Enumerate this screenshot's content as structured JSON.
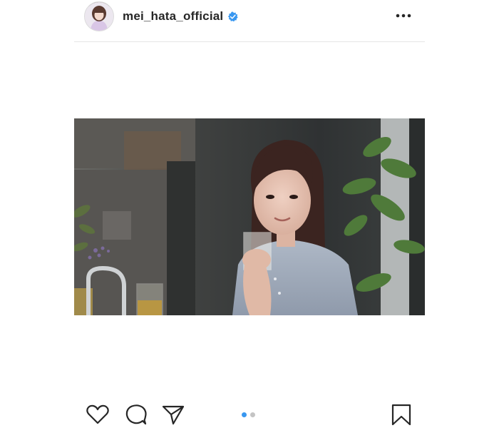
{
  "post": {
    "username": "mei_hata_official",
    "verified": true,
    "avatar_icon": "profile-avatar",
    "more_icon": "more-horizontal-icon"
  },
  "media": {
    "type": "photo",
    "carousel_total": 2,
    "carousel_active_index": 0
  },
  "actions": {
    "like_icon": "heart-icon",
    "comment_icon": "comment-bubble-icon",
    "share_icon": "paper-plane-icon",
    "save_icon": "bookmark-icon"
  },
  "colors": {
    "text": "#262626",
    "verified": "#3897f0",
    "divider": "#e6e6e6",
    "dot_active": "#3897f0",
    "dot_inactive": "#c4c4c4"
  }
}
